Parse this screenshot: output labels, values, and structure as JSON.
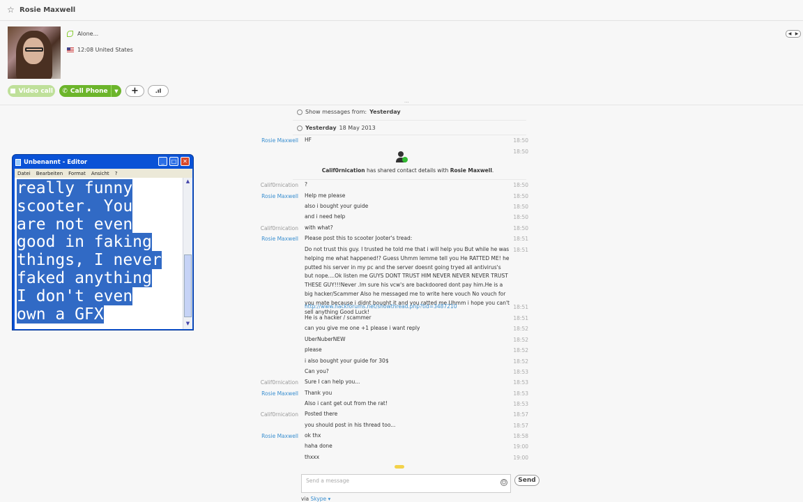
{
  "header": {
    "contact_name": "Rosie Maxwell"
  },
  "profile": {
    "mood": "Alone...",
    "location": "12:08 United States"
  },
  "buttons": {
    "video_call": "Video call",
    "call_phone": "Call Phone",
    "add": "+",
    "signal": ".ıl"
  },
  "chat": {
    "show_from_label": "Show messages from:",
    "show_from_value": "Yesterday",
    "date_day": "Yesterday",
    "date_rest": "18 May 2013",
    "share_user": "Calif0rnication",
    "share_text": "has shared contact details with",
    "share_target": "Rosie Maxwell",
    "share_time": "18:50",
    "messages": [
      {
        "sender": "Rosie Maxwell",
        "text": "HF",
        "time": "18:50"
      },
      {
        "sender": "Calif0rnication",
        "text": "?",
        "time": "18:50"
      },
      {
        "sender": "Rosie Maxwell",
        "text": "Help me please",
        "time": "18:50"
      },
      {
        "sender": "",
        "text": "also i bought your guide",
        "time": "18:50"
      },
      {
        "sender": "",
        "text": "and i need help",
        "time": "18:50"
      },
      {
        "sender": "Calif0rnication",
        "text": "with what?",
        "time": "18:50"
      },
      {
        "sender": "Rosie Maxwell",
        "text": "Please post this to scooter Jooter's tread:",
        "time": "18:51"
      },
      {
        "sender": "",
        "text": "Do not trust this guy. I trusted he told me that i will help you But while he was helping me what happened!? Guess Uhmm lemme tell you He RATTED ME! he putted his server in my pc and the server doesnt going tryed all antivirus's but nope....Ok listen me GUYS DONT TRUST HIM NEVER NEVER NEVER TRUST THESE GUY!!!Never .Im sure his vcw's are backdoored dont pay him.He is a big hacker/Scammer Also he messaged me to write here vouch No vouch for you mate because i didnt bought it and you ratted me Uhmm i hope you can't sell anything Good Luck!",
        "time": "18:51"
      },
      {
        "sender": "",
        "text": "http://www.hackforums.net/showthread.php?tid=3487210",
        "time": "18:51",
        "link": true
      },
      {
        "sender": "",
        "text": "He is a hacker / scammer",
        "time": "18:51"
      },
      {
        "sender": "",
        "text": "can you give me one +1 please i want reply",
        "time": "18:52"
      },
      {
        "sender": "",
        "text": "UberNuberNEW",
        "time": "18:52"
      },
      {
        "sender": "",
        "text": "please",
        "time": "18:52"
      },
      {
        "sender": "",
        "text": "i also bought your guide for 30$",
        "time": "18:52"
      },
      {
        "sender": "",
        "text": "Can you?",
        "time": "18:53"
      },
      {
        "sender": "Calif0rnication",
        "text": "Sure I can help you...",
        "time": "18:53"
      },
      {
        "sender": "Rosie Maxwell",
        "text": "Thank you",
        "time": "18:53"
      },
      {
        "sender": "",
        "text": "Also i cant get out from the rat!",
        "time": "18:53"
      },
      {
        "sender": "Calif0rnication",
        "text": "Posted there",
        "time": "18:57"
      },
      {
        "sender": "",
        "text": "you should post in his thread too...",
        "time": "18:57"
      },
      {
        "sender": "Rosie Maxwell",
        "text": "ok thx",
        "time": "18:58"
      },
      {
        "sender": "",
        "text": "haha done",
        "time": "19:00"
      },
      {
        "sender": "",
        "text": "thxxx",
        "time": "19:00"
      }
    ],
    "input_placeholder": "Send a message",
    "send_label": "Send",
    "via_label": "via",
    "via_service": "Skype ▾"
  },
  "notepad": {
    "title": "Unbenannt - Editor",
    "menu": [
      "Datei",
      "Bearbeiten",
      "Format",
      "Ansicht",
      "?"
    ],
    "lines": [
      "really funny",
      "scooter. You",
      "are not even",
      "good in faking",
      "things, I never",
      "faked anything",
      "I don't even",
      "own a GFX"
    ]
  }
}
